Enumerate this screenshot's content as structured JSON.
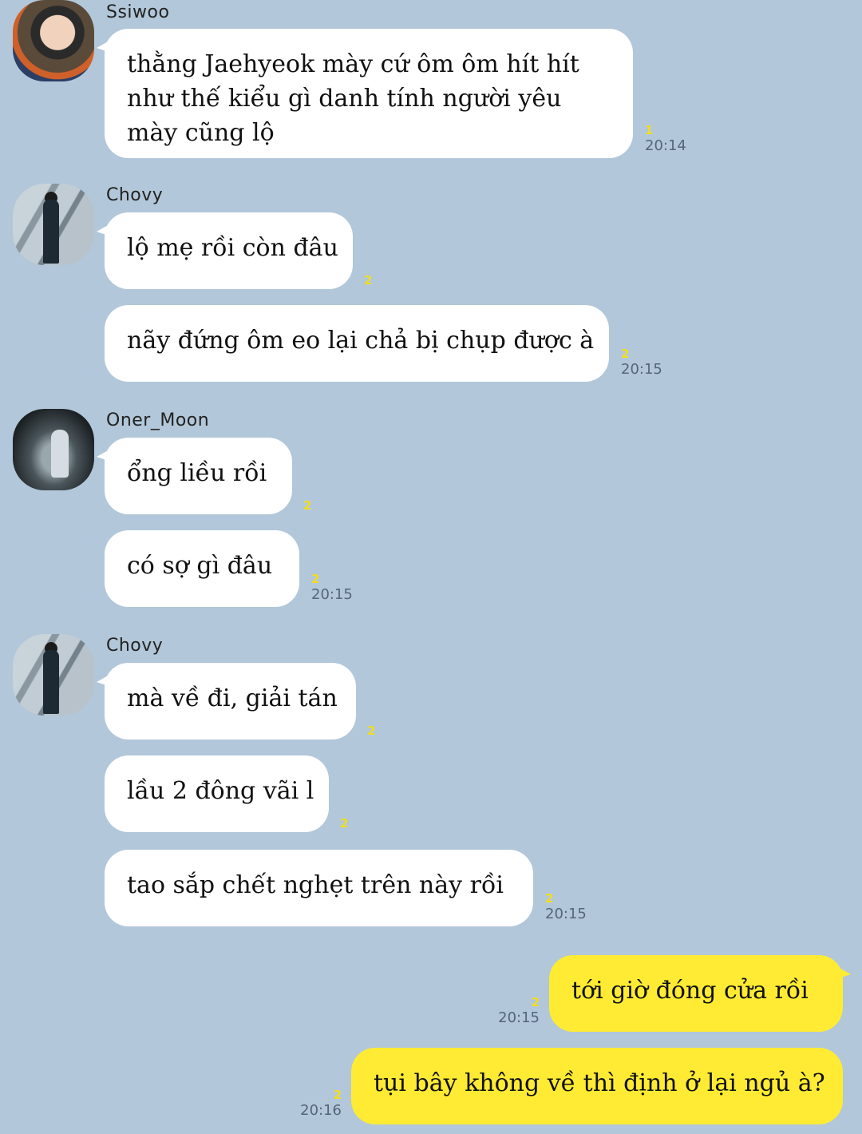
{
  "messages": [
    {
      "sender": "Ssiwoo",
      "text_lines": [
        "thằng Jaehyeok mày cứ ôm ôm hít hít",
        "như thế kiểu gì danh tính người yêu",
        "mày cũng lộ"
      ],
      "unread": "1",
      "time": "20:14"
    },
    {
      "sender": "Chovy",
      "text": "lộ mẹ rồi còn đâu",
      "unread": "2"
    },
    {
      "text": "nãy đứng ôm eo lại chả bị chụp được à",
      "unread": "2",
      "time": "20:15"
    },
    {
      "sender": "Oner_Moon",
      "text": "ổng liều rồi",
      "unread": "2"
    },
    {
      "text": "có sợ gì đâu",
      "unread": "2",
      "time": "20:15"
    },
    {
      "sender": "Chovy",
      "text": "mà về đi, giải tán",
      "unread": "2"
    },
    {
      "text": "lầu 2 đông vãi l",
      "unread": "2"
    },
    {
      "text": "tao sắp chết nghẹt trên này rồi",
      "unread": "2",
      "time": "20:15"
    },
    {
      "mine": true,
      "text": "tới giờ đóng cửa rồi",
      "unread": "2",
      "time": "20:15"
    },
    {
      "mine": true,
      "text": "tụi bây không về thì định ở lại ngủ à?",
      "unread": "2",
      "time": "20:16"
    }
  ],
  "colors": {
    "background": "#b2c7d9",
    "incoming_bubble": "#ffffff",
    "outgoing_bubble": "#ffeb33",
    "unread": "#f2dc20"
  }
}
